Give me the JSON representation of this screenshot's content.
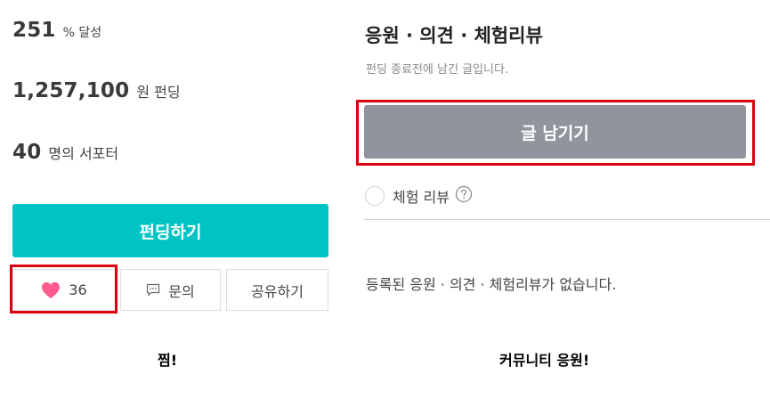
{
  "stats": {
    "achieve": {
      "value": "251",
      "unit": "% 달성"
    },
    "amount": {
      "value": "1,257,100",
      "unit": "원 펀딩"
    },
    "supporters": {
      "value": "40",
      "unit": "명의 서포터"
    }
  },
  "actions": {
    "fund_label": "펀딩하기",
    "like_count": "36",
    "inquiry_label": "문의",
    "share_label": "공유하기"
  },
  "captions": {
    "left": "찜!",
    "right": "커뮤니티 응원!"
  },
  "community": {
    "title": "응원 · 의견 · 체험리뷰",
    "description": "펀딩 종료전에 남긴 글입니다.",
    "write_label": "글 남기기",
    "review_label": "체험 리뷰",
    "empty_text": "등록된 응원 · 의견 · 체험리뷰가 없습니다."
  },
  "colors": {
    "fund_button": "#00c4c4",
    "write_button": "#90949c",
    "heart": "#ff5c8d",
    "highlight_box": "#d9000f"
  },
  "icons": {
    "heart": "heart-icon",
    "chat": "chat-bubble-icon",
    "help": "question-mark-icon"
  }
}
